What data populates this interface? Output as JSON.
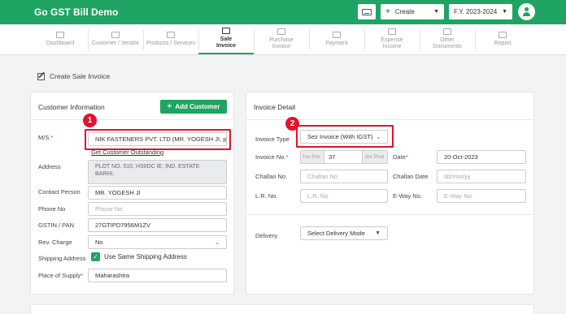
{
  "app": {
    "title": "Go GST Bill Demo"
  },
  "topbar": {
    "create_label": "Create",
    "fy_label": "F.Y. 2023-2024"
  },
  "nav": {
    "items": [
      {
        "label": "Dashboard"
      },
      {
        "label": "Customer / Vendor"
      },
      {
        "label": "Products / Services"
      },
      {
        "label": "Sale\nInvoice"
      },
      {
        "label": "Purchase\nInvoice"
      },
      {
        "label": "Payment"
      },
      {
        "label": "Expense\nIncome"
      },
      {
        "label": "Other\nDocuments"
      },
      {
        "label": "Report"
      }
    ]
  },
  "page": {
    "title": "Create Sale Invoice"
  },
  "customer": {
    "section_title": "Customer Information",
    "add_customer_label": "Add Customer",
    "ms_label": "M/S.",
    "ms_value": "NIK FASTENERS PVT. LTD (MR. YOGESH JI, p...",
    "outstanding_link": "Get Customer Outstanding",
    "address_label": "Address",
    "address_value": "PLOT NO. 510, HSIIDC IE, IND. ESTATE\nBARHI,",
    "contact_label": "Contact Person",
    "contact_value": "MR. YOGESH JI",
    "phone_label": "Phone No",
    "phone_placeholder": "Phone No",
    "gstin_label": "GSTIN / PAN",
    "gstin_value": "27GTIPD7956M1ZV",
    "rev_label": "Rev. Charge",
    "rev_value": "No",
    "shipping_label": "Shipping Address",
    "shipping_check_label": "Use Same Shipping Address",
    "supply_label": "Place of Supply",
    "supply_value": "Maharashtra"
  },
  "invoice": {
    "section_title": "Invoice Detail",
    "type_label": "Invoice Type",
    "type_value": "Sez Invoice (With IGST)",
    "no_label": "Invoice No.",
    "pre_placeholder": "Inv Pre.",
    "no_value": "37",
    "post_placeholder": "Inv Post",
    "date_label": "Date",
    "date_value": "20-Oct-2023",
    "challan_label": "Challan No.",
    "challan_placeholder": "Challan No",
    "challan_date_label": "Challan Date",
    "challan_date_placeholder": "dd/mm/yy",
    "lr_label": "L.R. No.",
    "lr_placeholder": "L.R. No.",
    "eway_label": "E-Way No.",
    "eway_placeholder": "E-Way No.",
    "delivery_label": "Delivery",
    "delivery_value": "Select Delivery Mode"
  },
  "annotations": {
    "badge1": "1",
    "badge2": "2"
  },
  "colors": {
    "brand": "#1fa463",
    "highlight": "#e0142b"
  }
}
